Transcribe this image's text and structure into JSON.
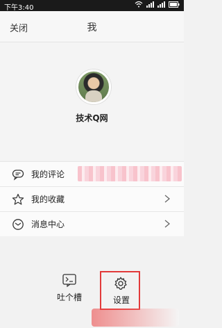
{
  "status_bar": {
    "time": "下午3:40"
  },
  "nav": {
    "close": "关闭",
    "title": "我"
  },
  "profile": {
    "username": "技术Q网"
  },
  "menu": [
    {
      "label": "我的评论",
      "icon": "comment-icon"
    },
    {
      "label": "我的收藏",
      "icon": "star-icon"
    },
    {
      "label": "消息中心",
      "icon": "message-icon"
    }
  ],
  "bottom": {
    "tucao_label": "吐个槽",
    "settings_label": "设置"
  },
  "colors": {
    "highlight_border": "#e23a3a",
    "status_bar": "#1a1a1a"
  }
}
